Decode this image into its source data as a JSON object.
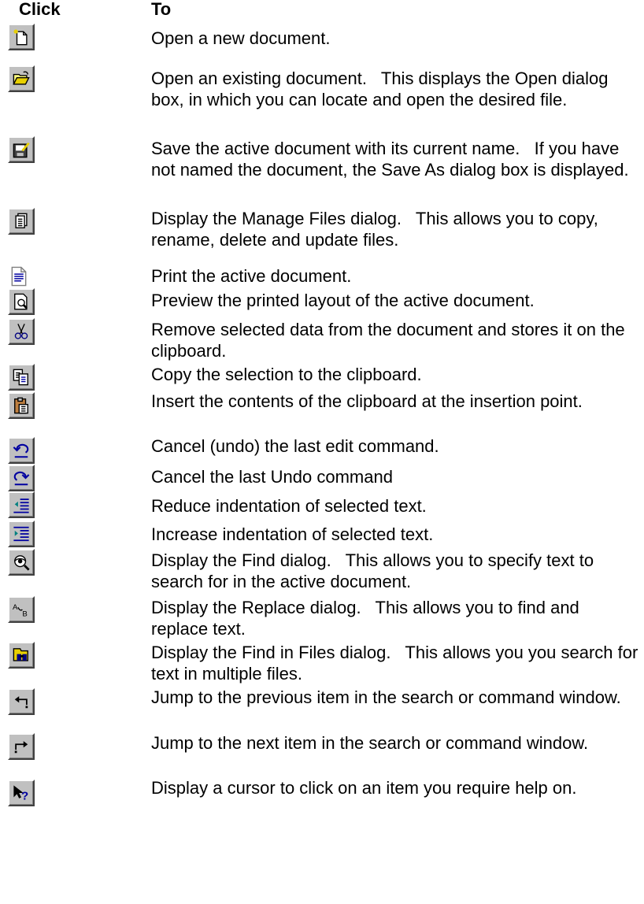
{
  "header": {
    "click": "Click",
    "to": "To"
  },
  "rows": [
    {
      "icon": "new-document-icon",
      "text": "Open a new document."
    },
    {
      "icon": "open-folder-icon",
      "text": "Open an existing document.   This displays the Open dialog box, in which you can locate and open the desired file."
    },
    {
      "icon": "save-icon",
      "text": "Save the active document with its current name.   If you have not named the document, the Save As dialog box is displayed."
    },
    {
      "icon": "manage-files-icon",
      "text": "Display the Manage Files dialog.   This allows you to copy, rename, delete and update files."
    },
    {
      "icon": "print-icon",
      "text": "Print the active document."
    },
    {
      "icon": "print-preview-icon",
      "text": "Preview the printed layout of the active document."
    },
    {
      "icon": "cut-icon",
      "text": "Remove selected data from the document and stores it on the clipboard."
    },
    {
      "icon": "copy-icon",
      "text": "Copy the selection to the clipboard."
    },
    {
      "icon": "paste-icon",
      "text": "Insert the contents of the clipboard at the insertion point."
    },
    {
      "icon": "undo-icon",
      "text": "Cancel (undo) the last edit command."
    },
    {
      "icon": "redo-icon",
      "text": "Cancel the last Undo command"
    },
    {
      "icon": "decrease-indent-icon",
      "text": "Reduce indentation of selected text."
    },
    {
      "icon": "increase-indent-icon",
      "text": "Increase indentation of selected text."
    },
    {
      "icon": "find-icon",
      "text": "Display the Find dialog.   This allows you to specify text to search for in the active document."
    },
    {
      "icon": "replace-icon",
      "text": "Display the Replace dialog.   This allows you to find and replace text."
    },
    {
      "icon": "find-in-files-icon",
      "text": "Display the Find in Files dialog.   This allows you you search for text in multiple files."
    },
    {
      "icon": "previous-item-icon",
      "text": "Jump to the previous item in the search or command window."
    },
    {
      "icon": "next-item-icon",
      "text": "Jump to the next item in the search or command window."
    },
    {
      "icon": "context-help-icon",
      "text": "Display a cursor to click on an item you require help on."
    }
  ]
}
